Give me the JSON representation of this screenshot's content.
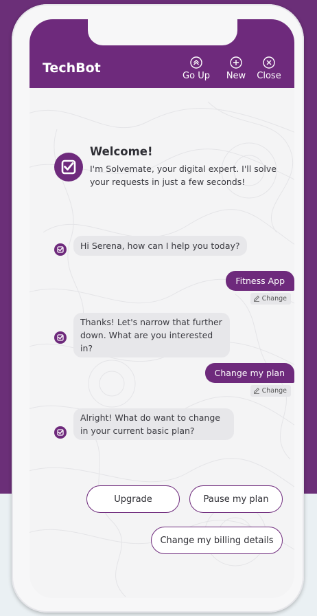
{
  "header": {
    "title": "TechBot",
    "buttons": [
      {
        "label": "Go Up",
        "icon": "chevron-up-circle-icon"
      },
      {
        "label": "New",
        "icon": "plus-circle-icon"
      },
      {
        "label": "Close",
        "icon": "close-circle-icon"
      }
    ]
  },
  "welcome": {
    "title": "Welcome!",
    "text": "I'm Solvemate, your digital expert. I'll solve your requests in just a few seconds!"
  },
  "messages": [
    {
      "from": "bot",
      "text": "Hi Serena, how can I help you today?"
    },
    {
      "from": "user",
      "text": "Fitness App",
      "change_label": "Change"
    },
    {
      "from": "bot",
      "text": "Thanks! Let's narrow that further down. What are you interested in?"
    },
    {
      "from": "user",
      "text": "Change my plan",
      "change_label": "Change"
    },
    {
      "from": "bot",
      "text": "Alright! What do want to change in your current basic plan?"
    }
  ],
  "quick_replies": [
    "Upgrade",
    "Pause my plan",
    "Change my billing details"
  ],
  "colors": {
    "brand": "#6e2a7c",
    "background": "#6b2f78",
    "bubble_bot": "#e7e7ea",
    "screen": "#f4f4f5"
  }
}
